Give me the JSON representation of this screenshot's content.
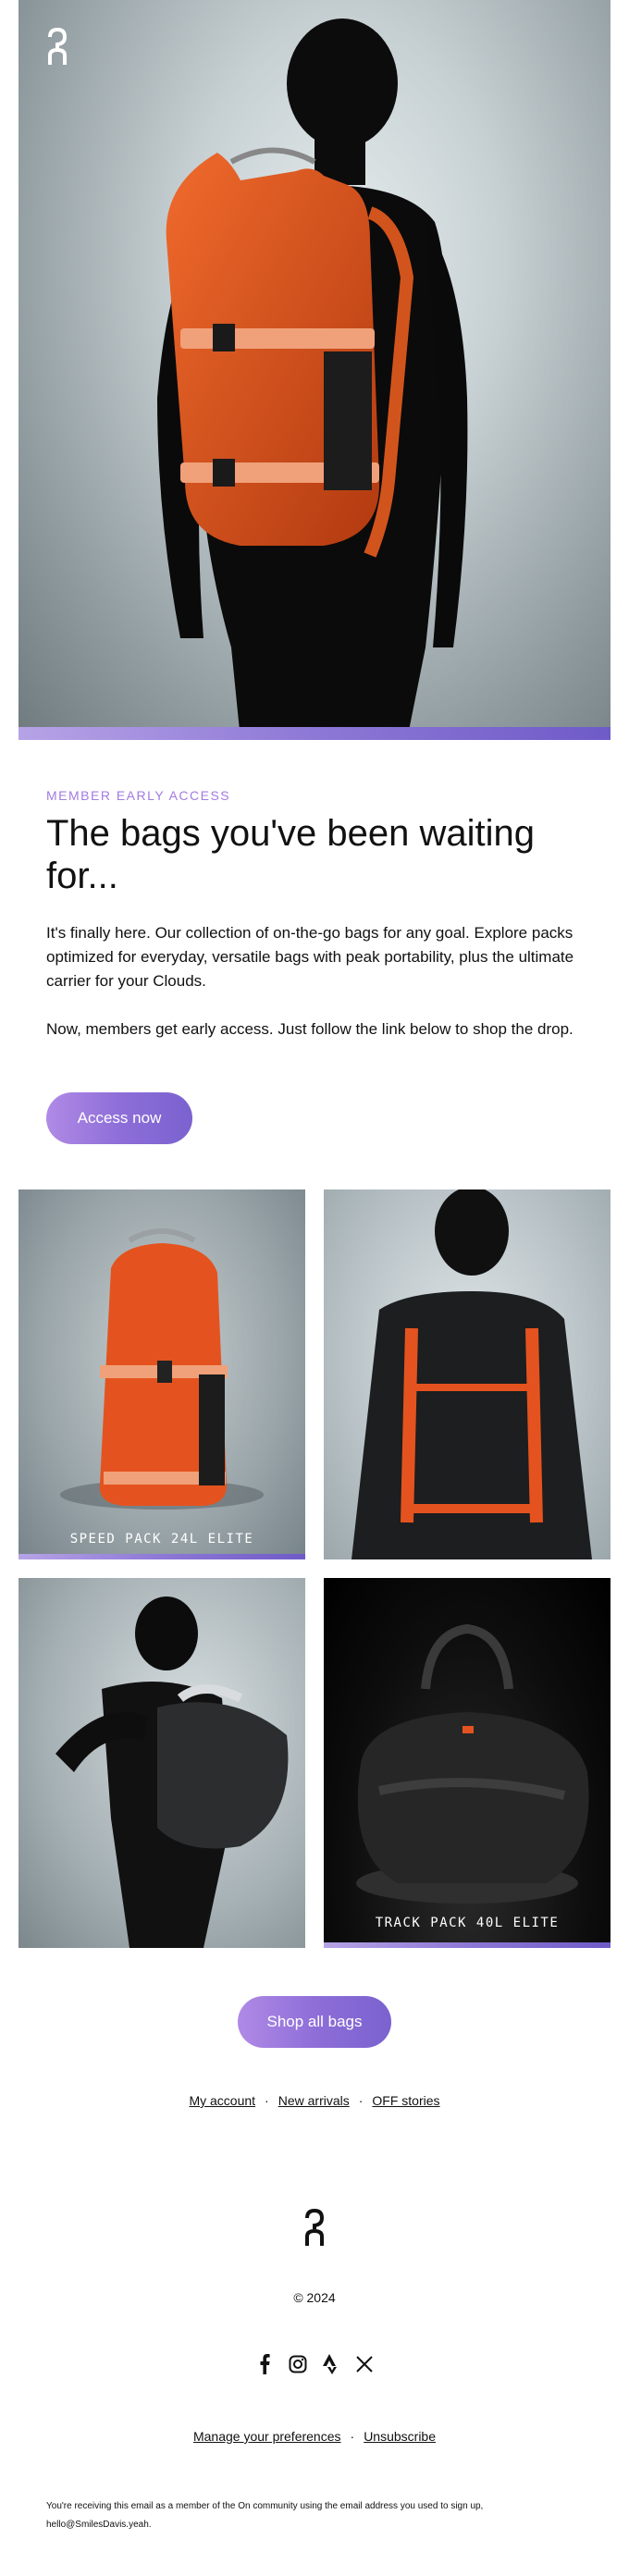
{
  "hero": {
    "colors": {
      "backpack": "#e4531f",
      "strip": "#8d78d6"
    }
  },
  "intro": {
    "eyebrow": "MEMBER EARLY ACCESS",
    "headline": "The bags you've been waiting for...",
    "paragraph1": "It's finally here. Our collection of on-the-go bags for any goal. Explore packs optimized for everyday, versatile bags with peak portability, plus the ultimate carrier for your Clouds.",
    "paragraph2": "Now, members get early access. Just follow the link below to shop the drop.",
    "cta": "Access now"
  },
  "tiles": [
    {
      "label": "SPEED PACK 24L ELITE"
    },
    {
      "label": ""
    },
    {
      "label": ""
    },
    {
      "label": "TRACK PACK 40L ELITE"
    }
  ],
  "shop_cta": "Shop all bags",
  "links": [
    "My account",
    "New arrivals",
    "OFF stories"
  ],
  "footer": {
    "copyright": "© 2024",
    "social_icons": [
      "facebook-icon",
      "instagram-icon",
      "strava-icon",
      "x-icon"
    ],
    "manage": "Manage your preferences",
    "unsubscribe": "Unsubscribe",
    "legal": "You're receiving this email as a member of the On community using the email address you used to sign up, hello@SmilesDavis.yeah."
  }
}
